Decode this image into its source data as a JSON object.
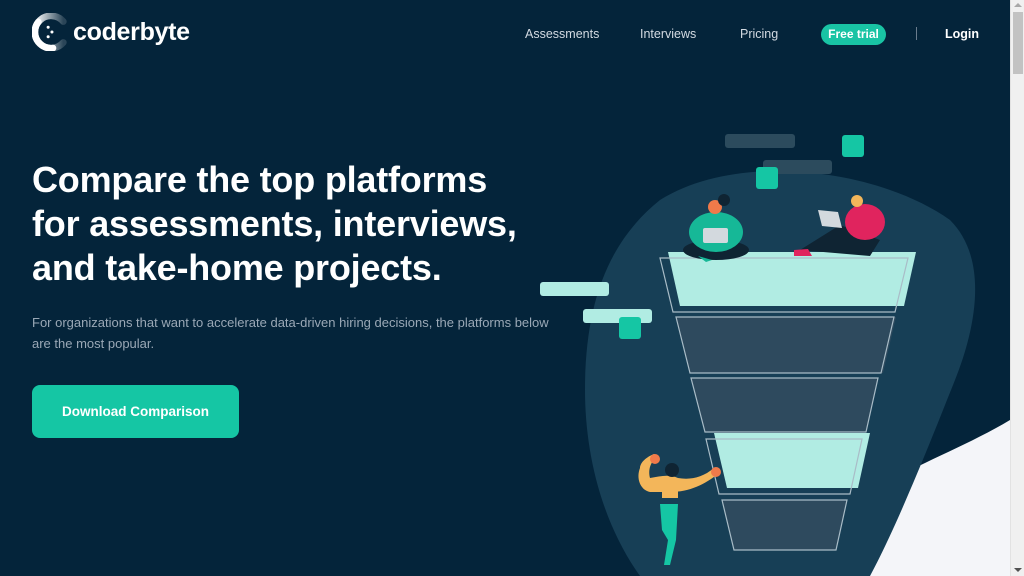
{
  "brand": {
    "name": "coderbyte",
    "logo_icon": "coderbyte-c-logo-icon"
  },
  "nav": {
    "items": [
      {
        "label": "Assessments"
      },
      {
        "label": "Interviews"
      },
      {
        "label": "Pricing"
      }
    ],
    "free_trial_label": "Free trial",
    "divider": "|",
    "login_label": "Login"
  },
  "hero": {
    "title_lines": [
      "Compare the top platforms",
      "for assessments, interviews,",
      "and take-home projects."
    ],
    "subtitle": "For organizations that want to accelerate data-driven hiring decisions, the platforms below are the most popular.",
    "cta_label": "Download Comparison"
  },
  "illustration": {
    "description": "funnel-illustration-with-people",
    "icon": "hiring-funnel-icon"
  },
  "colors": {
    "background": "#04243a",
    "accent": "#15c6a4",
    "blob": "#173f56",
    "funnel_light": "#b1ece3",
    "light_bg": "#f4f5f9"
  }
}
